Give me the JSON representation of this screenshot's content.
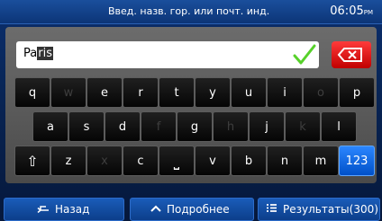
{
  "header": {
    "title": "Введ. назв. гор. или почт. инд.",
    "time": "06:05",
    "ampm": "PM"
  },
  "input": {
    "typed": "Pa",
    "suggestion": "ris"
  },
  "keyboard": {
    "rows": [
      [
        "q",
        "w",
        "e",
        "r",
        "t",
        "y",
        "u",
        "i",
        "o",
        "p"
      ],
      [
        "a",
        "s",
        "d",
        "f",
        "g",
        "h",
        "j",
        "k",
        "l"
      ],
      [
        "z",
        "x",
        "c",
        "v",
        "b",
        "n",
        "m"
      ]
    ],
    "shift_label": "⇧",
    "space_label": "⎵",
    "numbers_label": "123"
  },
  "footer": {
    "back": "Назад",
    "more": "Подробнее",
    "results": "Результаты(300)"
  }
}
